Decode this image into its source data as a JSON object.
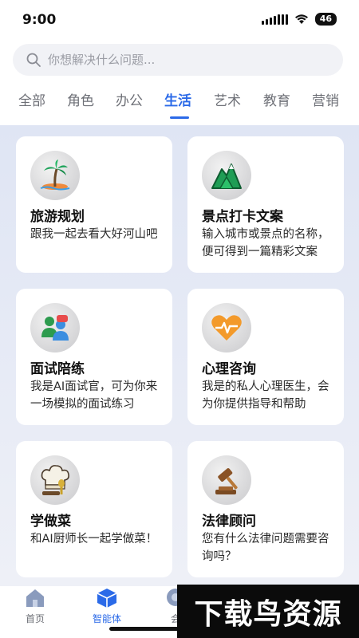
{
  "status": {
    "time": "9:00",
    "battery": "46"
  },
  "search": {
    "placeholder": "你想解决什么问题..."
  },
  "tabs": [
    "全部",
    "角色",
    "办公",
    "生活",
    "艺术",
    "教育",
    "营销"
  ],
  "active_tab": "生活",
  "cards": [
    {
      "title": "旅游规划",
      "desc": "跟我一起去看大好河山吧",
      "icon": "palm-island-icon"
    },
    {
      "title": "景点打卡文案",
      "desc": "输入城市或景点的名称，便可得到一篇精彩文案",
      "icon": "mountain-icon"
    },
    {
      "title": "面试陪练",
      "desc": "我是AI面试官，可为你来一场模拟的面试练习",
      "icon": "interview-people-icon"
    },
    {
      "title": "心理咨询",
      "desc": "我是的私人心理医生，会为你提供指导和帮助",
      "icon": "heart-pulse-icon"
    },
    {
      "title": "学做菜",
      "desc": "和AI厨师长一起学做菜！",
      "icon": "chef-hat-icon"
    },
    {
      "title": "法律顾问",
      "desc": "您有什么法律问题需要咨询吗？",
      "icon": "gavel-icon"
    }
  ],
  "nav": [
    {
      "label": "首页",
      "icon": "home-icon"
    },
    {
      "label": "智能体",
      "icon": "cube-icon"
    },
    {
      "label": "会",
      "icon": "chat-icon"
    }
  ],
  "watermark": "下载鸟资源",
  "colors": {
    "accent": "#2b6ae8",
    "background": "#dfe5f4"
  }
}
